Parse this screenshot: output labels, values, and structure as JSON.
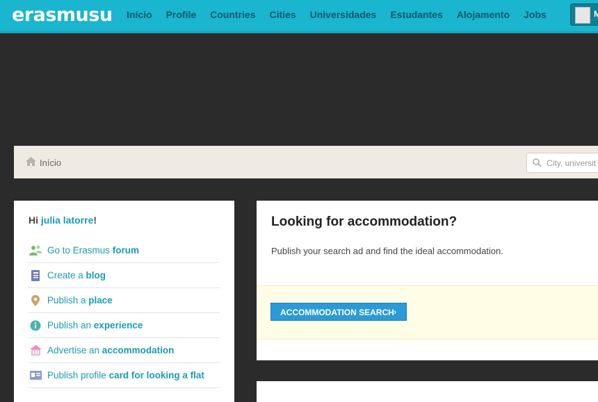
{
  "header": {
    "logo": "erasmusu",
    "nav": [
      "Inicio",
      "Profile",
      "Countries",
      "Cities",
      "Universidades",
      "Estudantes",
      "Alojamento",
      "Jobs"
    ],
    "profile_initial": "M"
  },
  "breadcrumb": {
    "home": "Início"
  },
  "search": {
    "placeholder": "City, universit"
  },
  "sidebar": {
    "greeting_prefix": "Hi ",
    "username": "julia latorre",
    "greeting_suffix": "!",
    "items": [
      {
        "pre": "Go to Erasmus ",
        "bold": "forum",
        "icon": "people-icon",
        "color": "#7cb86a"
      },
      {
        "pre": "Create a ",
        "bold": "blog",
        "icon": "notebook-icon",
        "color": "#6f7fb5"
      },
      {
        "pre": "Publish a ",
        "bold": "place",
        "icon": "map-pin-icon",
        "color": "#c9a36a"
      },
      {
        "pre": "Publish an ",
        "bold": "experience",
        "icon": "info-icon",
        "color": "#47b3b0"
      },
      {
        "pre": "Advertise an ",
        "bold": "accommodation",
        "icon": "house-icon",
        "color": "#e58fbf"
      },
      {
        "pre": "Publish profile ",
        "bold": "card for looking a flat",
        "icon": "id-card-icon",
        "color": "#8a9fc3"
      }
    ]
  },
  "accommodation": {
    "title": "Looking for accommodation?",
    "text": "Publish your search ad and find the ideal accommodation.",
    "button": "ACCOMMODATION SEARCH",
    "button_arrow": "›"
  }
}
